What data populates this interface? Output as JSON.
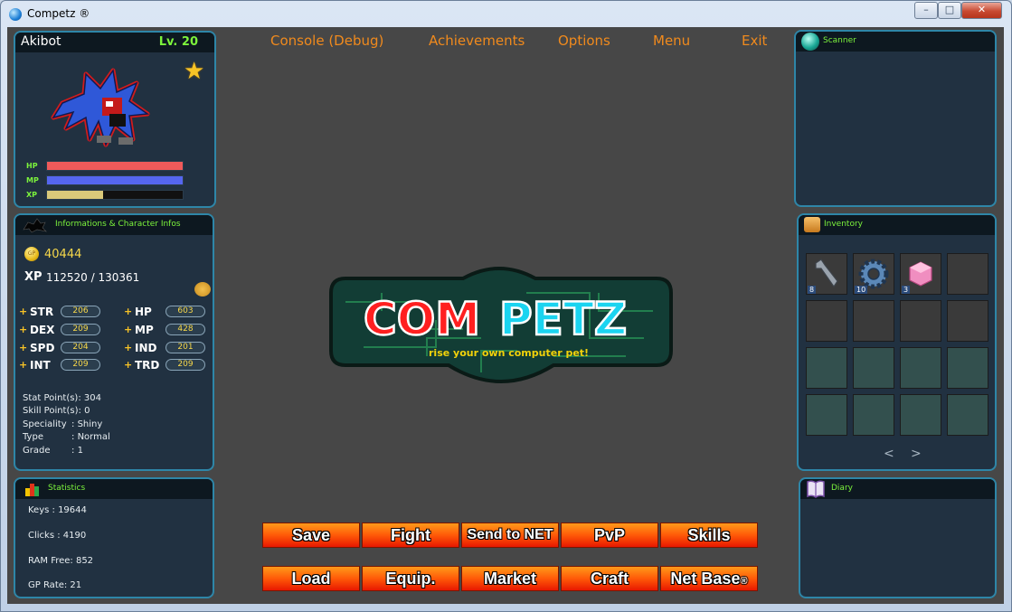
{
  "window": {
    "title": "Competz ®",
    "controls": {
      "minimize": "–",
      "maximize": "□",
      "close": "✕"
    }
  },
  "pet": {
    "name": "Akibot",
    "level": "Lv. 20",
    "bars": [
      {
        "label": "HP",
        "fill": 1.0,
        "color": "#f05a5a"
      },
      {
        "label": "MP",
        "fill": 1.0,
        "color": "#5566f0"
      },
      {
        "label": "XP",
        "fill": 0.41,
        "color": "#d9c97a"
      }
    ]
  },
  "info": {
    "title": "Informations & Character Infos",
    "gp_coin_text": "GP",
    "gp": "40444",
    "xp_label": "XP",
    "xp": "112520 / 130361",
    "stats_left": [
      {
        "name": "STR",
        "value": "206"
      },
      {
        "name": "DEX",
        "value": "209"
      },
      {
        "name": "SPD",
        "value": "204"
      },
      {
        "name": "INT",
        "value": "209"
      }
    ],
    "stats_right": [
      {
        "name": "HP",
        "value": "603"
      },
      {
        "name": "MP",
        "value": "428"
      },
      {
        "name": "IND",
        "value": "201"
      },
      {
        "name": "TRD",
        "value": "209"
      }
    ],
    "plus": "+",
    "details": [
      {
        "key": "Stat Point(s)",
        "sep": ":",
        "value": "304"
      },
      {
        "key": "Skill Point(s)",
        "sep": ":",
        "value": "0"
      },
      {
        "key": "Speciality",
        "sep": ":",
        "value": "Shiny"
      },
      {
        "key": "Type",
        "sep": ":",
        "value": "Normal"
      },
      {
        "key": "Grade",
        "sep": ":",
        "value": "1"
      }
    ]
  },
  "statistics": {
    "title": "Statistics",
    "lines": [
      "Keys : 19644",
      "Clicks : 4190",
      "RAM Free: 852",
      "GP Rate: 21"
    ]
  },
  "menu": {
    "items": [
      "Console (Debug)",
      "Achievements",
      "Options",
      "Menu",
      "Exit"
    ]
  },
  "logo": {
    "com": "COM",
    "petz": "PETZ",
    "tagline": "rise your own computer pet!"
  },
  "buttons": {
    "row1": [
      "Save",
      "Fight",
      "Send to NET",
      "PvP",
      "Skills"
    ],
    "row2": [
      "Load",
      "Equip.",
      "Market",
      "Craft",
      "Net Base"
    ],
    "netbase_mark": "®"
  },
  "scanner": {
    "title": "Scanner"
  },
  "inventory": {
    "title": "Inventory",
    "items": [
      {
        "name": "wrench-item",
        "qty": "8"
      },
      {
        "name": "gear-item",
        "qty": "10"
      },
      {
        "name": "pink-cube-item",
        "qty": "3"
      }
    ],
    "prev": "<",
    "next": ">"
  },
  "diary": {
    "title": "Diary"
  },
  "colors": {
    "accent_orange": "#f08a1d",
    "panel_border": "#2e86a8",
    "label_green": "#7cf33c",
    "gold": "#f7d84a"
  }
}
